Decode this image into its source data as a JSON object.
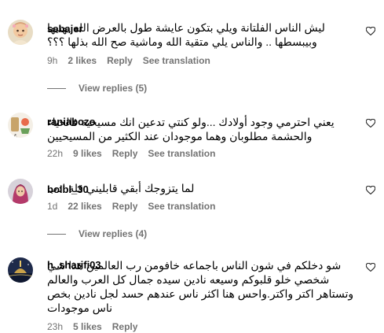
{
  "colors": {
    "text": "#000000",
    "secondary": "#737373",
    "background": "#ffffff"
  },
  "comments": [
    {
      "username": "sebajer",
      "text": "ليش الناس الفلتانة ويلي بتكون عايشة طول بالعرض الله يهنيها وبيبسطها .. والناس يلي متقية الله وماشية صح الله بذلها ؟؟؟",
      "time": "9h",
      "likes": "2 likes",
      "reply": "Reply",
      "translate": "See translation",
      "view_replies": "View replies (5)"
    },
    {
      "username": "raniabozo",
      "text": "يعني احترمي وجود أولادك ...ولو كنتي تدعين انك مسيحية فالحياء والحشمة مطلوبان وهما موجودان عند الكثير من المسيحيين",
      "time": "22h",
      "likes": "9 likes",
      "reply": "Reply",
      "translate": "See translation"
    },
    {
      "username": "bolbl_30",
      "text": "لما يتزوجك أبقي قابليني قلة ادب",
      "time": "1d",
      "likes": "22 likes",
      "reply": "Reply",
      "translate": "See translation",
      "view_replies": "View replies (4)"
    },
    {
      "username": "h_sharifi03",
      "text": "شو دخلكم في شون الناس باجماعه خافومن رب العالمين هذا شي شخصي خلو قلبوكم وسيعه نادين سيده جمال كل العرب والعالم وتستاهر اكتر واكتر.واحس هنا اكثر ناس عندهم حسد لجل نادين بخص ناس موجودات",
      "time": "23h",
      "likes": "5 likes",
      "reply": "Reply"
    }
  ]
}
